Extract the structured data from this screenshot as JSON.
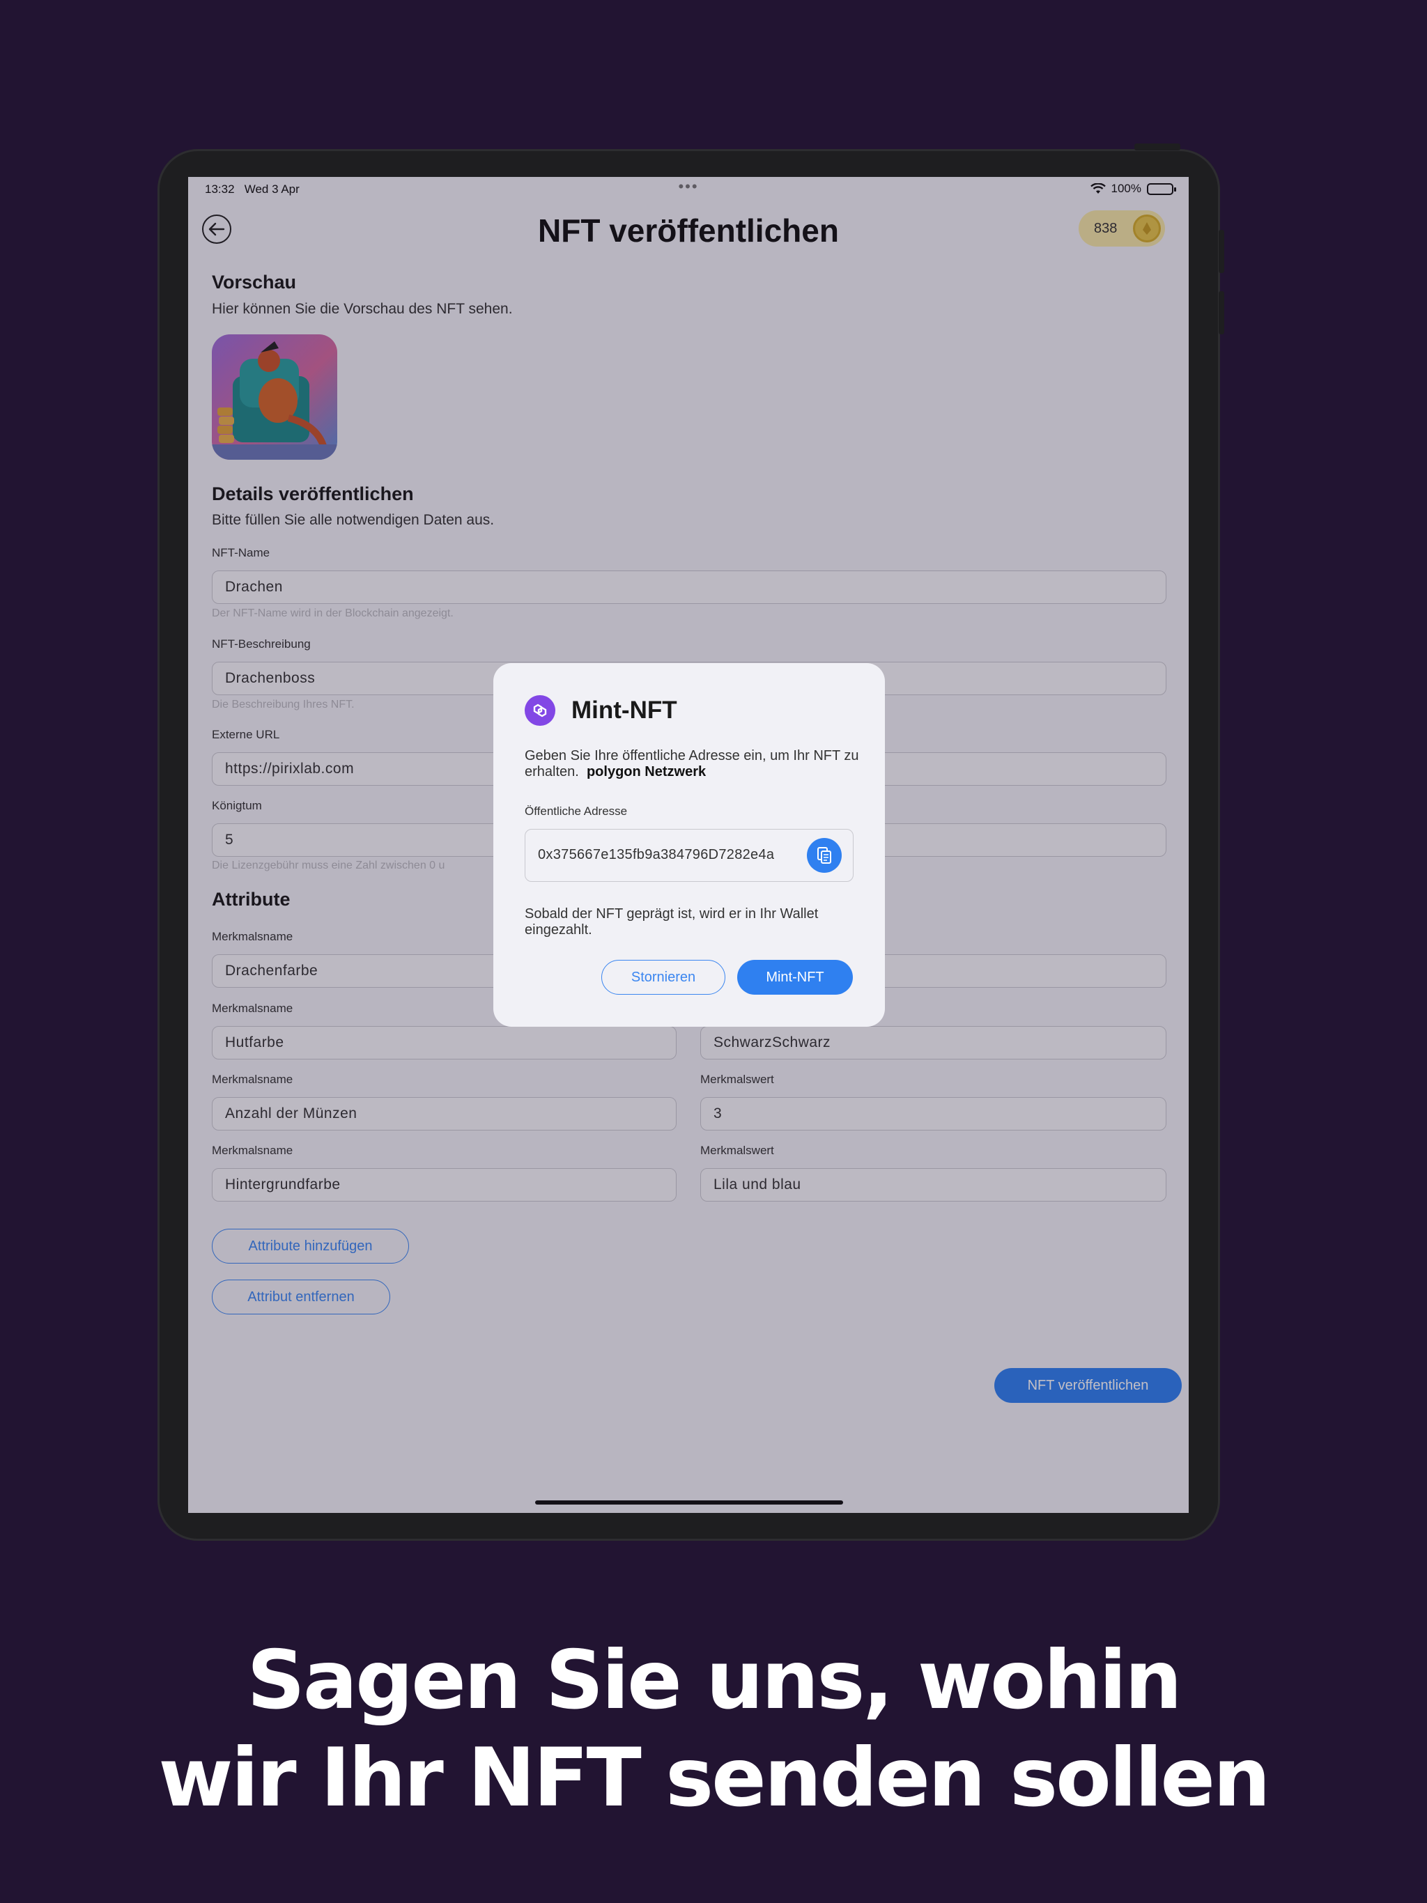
{
  "status_bar": {
    "time": "13:32",
    "date": "Wed 3 Apr",
    "dots": "•••",
    "battery": "100%"
  },
  "header": {
    "title": "NFT veröffentlichen",
    "coins": "838",
    "back_icon": "arrow-left-icon"
  },
  "preview": {
    "title": "Vorschau",
    "subtitle": "Hier können Sie die Vorschau des NFT sehen."
  },
  "details": {
    "title": "Details veröffentlichen",
    "subtitle": "Bitte füllen Sie alle notwendigen Daten aus.",
    "name_label": "NFT-Name",
    "name_value": "Drachen",
    "name_hint": "Der NFT-Name wird in der Blockchain angezeigt.",
    "desc_label": "NFT-Beschreibung",
    "desc_value": "Drachenboss",
    "desc_hint": "Die Beschreibung Ihres NFT.",
    "url_label": "Externe URL",
    "url_value": "https://pirixlab.com",
    "royalty_label": "Königtum",
    "royalty_value": "5",
    "royalty_hint": "Die Lizenzgebühr muss eine Zahl zwischen 0 u"
  },
  "attributes": {
    "title": "Attribute",
    "name_label": "Merkmalsname",
    "value_label": "Merkmalswert",
    "rows": [
      {
        "name": "Drachenfarbe",
        "value": ""
      },
      {
        "name": "Hutfarbe",
        "value": "SchwarzSchwarz"
      },
      {
        "name": "Anzahl der Münzen",
        "value": "3"
      },
      {
        "name": "Hintergrundfarbe",
        "value": "Lila und blau"
      }
    ],
    "add_label": "Attribute hinzufügen",
    "remove_label": "Attribut entfernen"
  },
  "publish_label": "NFT veröffentlichen",
  "modal": {
    "title": "Mint-NFT",
    "text_main": "Geben Sie Ihre öffentliche Adresse ein, um Ihr NFT zu erhalten.",
    "text_network": "polygon Netzwerk",
    "address_label": "Öffentliche Adresse",
    "address_value": "0x375667e135fb9a384796D7282e4a",
    "info": "Sobald der NFT geprägt ist, wird er in Ihr Wallet eingezahlt.",
    "cancel_label": "Stornieren",
    "mint_label": "Mint-NFT",
    "accent": "#2f80f0",
    "logo_color": "#8247e5"
  },
  "caption": {
    "line1": "Sagen Sie uns, wohin",
    "line2": "wir Ihr NFT senden sollen"
  }
}
